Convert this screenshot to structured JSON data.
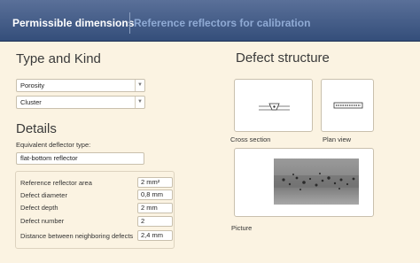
{
  "header": {
    "tab_active": "Permissible dimensions",
    "tab_inactive": "Reference reflectors for calibration"
  },
  "type_kind": {
    "title": "Type and Kind",
    "type_select": "Porosity",
    "kind_select": "Cluster"
  },
  "details": {
    "title": "Details",
    "reflector_label": "Equivalent deflector type:",
    "reflector_value": "flat-bottom reflector",
    "params": [
      {
        "label": "Reference reflector area",
        "value": "2 mm²"
      },
      {
        "label": "Defect diameter",
        "value": "0,8 mm"
      },
      {
        "label": "Defect depth",
        "value": "2 mm"
      },
      {
        "label": "Defect number",
        "value": "2"
      },
      {
        "label": "Distance between neighboring defects",
        "value": "2,4 mm"
      }
    ]
  },
  "defect_structure": {
    "title": "Defect structure",
    "cross_section": "Cross section",
    "plan_view": "Plan view",
    "picture": "Picture"
  },
  "colors": {
    "header": "#3f5785",
    "background": "#fbf3e2",
    "inactive_tab": "#8faad4"
  }
}
